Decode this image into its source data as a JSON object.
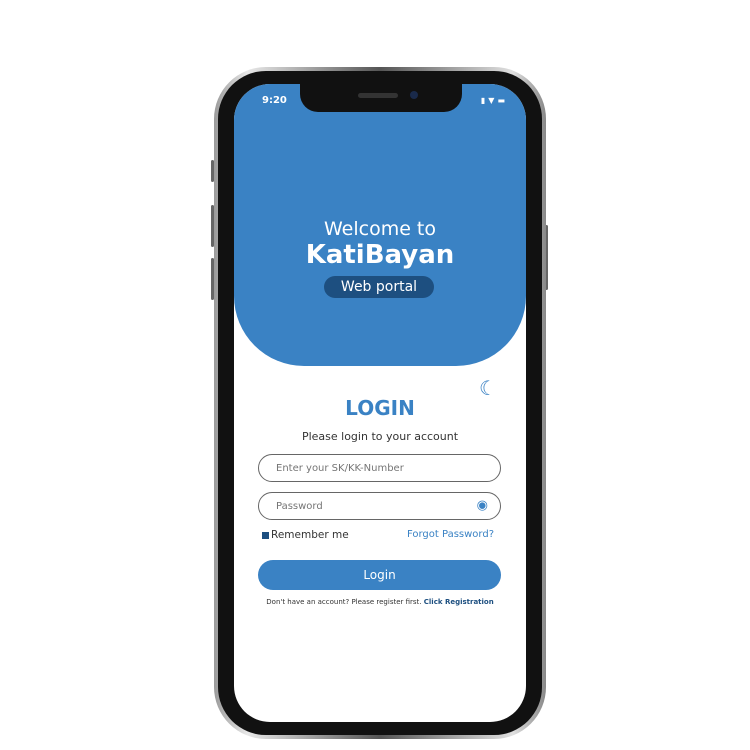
{
  "status_bar": {
    "time": "9:20",
    "icons": [
      "signal-icon",
      "wifi-icon",
      "battery-icon"
    ]
  },
  "header": {
    "welcome": "Welcome to",
    "brand": "KatiBayan",
    "badge": "Web portal"
  },
  "login": {
    "title": "LOGIN",
    "subtitle": "Please login to your account",
    "number_placeholder": "Enter your SK/KK-Number",
    "password_placeholder": "Password",
    "remember": "Remember me",
    "forgot": "Forgot Password?",
    "button": "Login",
    "register_prompt": "Don't have an account? Please register first.",
    "register_link": "Click Registration"
  },
  "colors": {
    "primary": "#3a82c4",
    "dark": "#1d4f80"
  }
}
